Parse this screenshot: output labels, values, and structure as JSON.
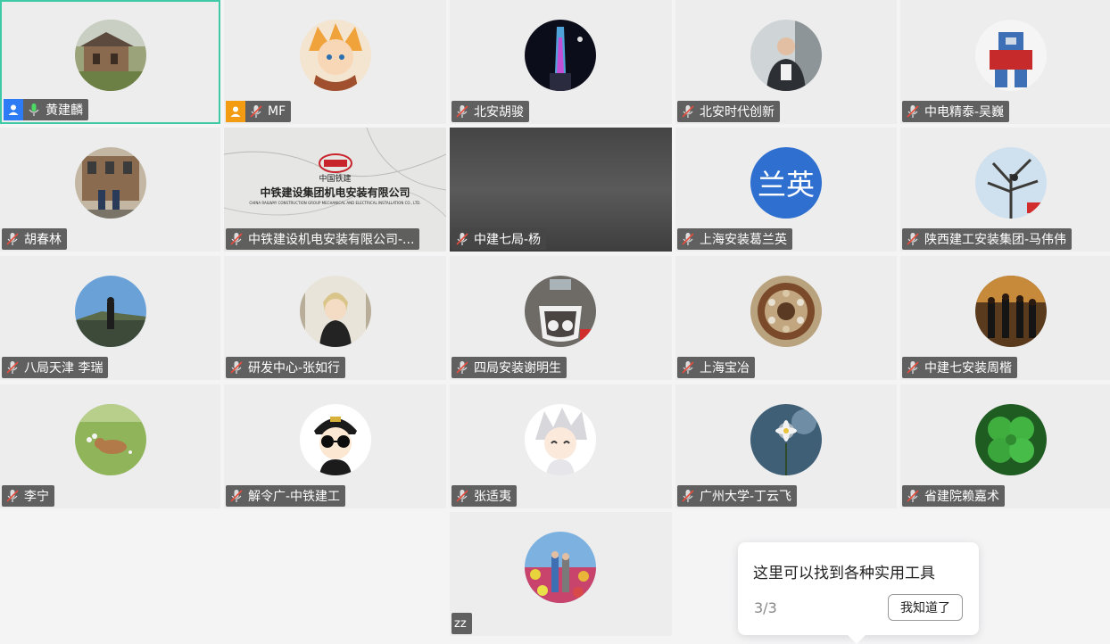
{
  "participants": [
    {
      "name": "黄建麟",
      "role_icon": "host-icon",
      "role_color": "#2d7cf6",
      "mic_icon": "mic-on-icon",
      "active": true
    },
    {
      "name": "MF",
      "role_icon": "cohost-icon",
      "role_color": "#f39c12",
      "mic_icon": "mic-muted-icon"
    },
    {
      "name": "北安胡骏",
      "mic_icon": "mic-muted-icon"
    },
    {
      "name": "北安时代创新",
      "mic_icon": "mic-muted-icon"
    },
    {
      "name": "中电精泰-吴巍",
      "mic_icon": "mic-muted-icon"
    },
    {
      "name": "胡春林",
      "mic_icon": "mic-muted-icon"
    },
    {
      "name": "中铁建设机电安装有限公司-...",
      "mic_icon": "mic-muted-icon",
      "video": true,
      "video_text": {
        "line1": "中国铁建",
        "line2": "中铁建设集团机电安装有限公司",
        "line3": "CHINA RAILWAY CONSTRUCTION GROUP MECHANICAL AND ELECTRICAL INSTALLATION CO., LTD."
      }
    },
    {
      "name": "中建七局-杨",
      "mic_icon": "mic-muted-icon",
      "video": true
    },
    {
      "name": "上海安装葛兰英",
      "mic_icon": "mic-muted-icon",
      "avatar_text": "兰英"
    },
    {
      "name": "陕西建工安装集团-马伟伟",
      "mic_icon": "mic-muted-icon"
    },
    {
      "name": "八局天津 李瑞",
      "mic_icon": "mic-muted-icon"
    },
    {
      "name": "研发中心-张如行",
      "mic_icon": "mic-muted-icon"
    },
    {
      "name": "四局安装谢明生",
      "mic_icon": "mic-muted-icon"
    },
    {
      "name": "上海宝冶",
      "mic_icon": "mic-muted-icon"
    },
    {
      "name": "中建七安装周楷",
      "mic_icon": "mic-muted-icon"
    },
    {
      "name": "李宁",
      "mic_icon": "mic-muted-icon"
    },
    {
      "name": "解令广-中铁建工",
      "mic_icon": "mic-muted-icon"
    },
    {
      "name": "张适夷",
      "mic_icon": "mic-muted-icon"
    },
    {
      "name": "广州大学-丁云飞",
      "mic_icon": "mic-muted-icon"
    },
    {
      "name": "省建院赖嘉术",
      "mic_icon": "mic-muted-icon"
    },
    {
      "name": "zz"
    }
  ],
  "tooltip": {
    "text": "这里可以找到各种实用工具",
    "step": "3/3",
    "button_label": "我知道了"
  },
  "colors": {
    "active_border": "#3ec9a7",
    "tag_bg": "#464646",
    "host": "#2d7cf6",
    "cohost": "#f39c12",
    "mic_on": "#4cd964",
    "mic_muted_slash": "#e74c3c"
  }
}
